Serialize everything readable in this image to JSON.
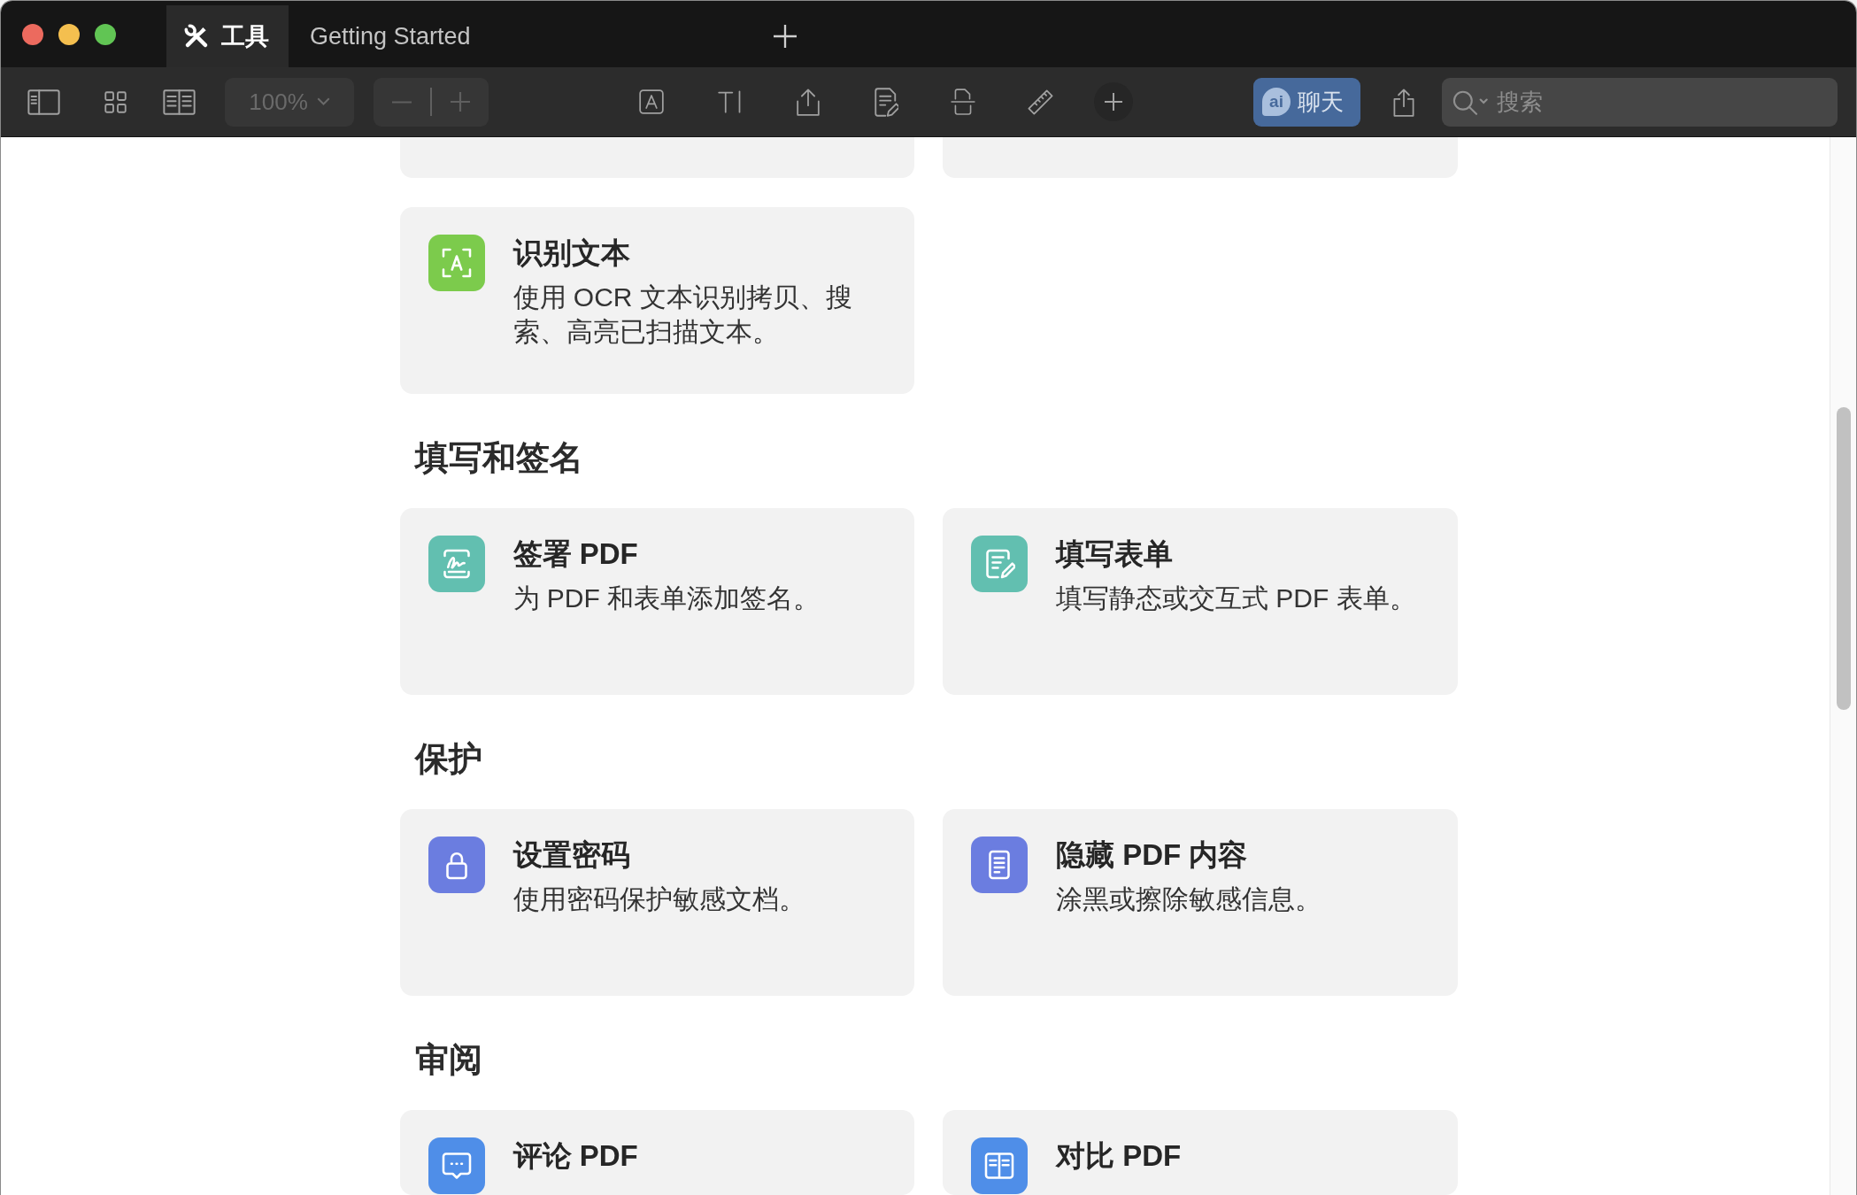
{
  "window": {
    "tabs": [
      {
        "label": "工具",
        "selected": true,
        "kind": "tools"
      },
      {
        "label": "Getting Started",
        "selected": false,
        "kind": "document"
      }
    ]
  },
  "toolbar": {
    "zoom_menu": {
      "value": "100%",
      "disabled": true
    },
    "zoom_stepper": {
      "disabled": true
    },
    "chat_button": {
      "badge": "ai",
      "label": "聊天"
    },
    "search": {
      "placeholder": "搜索"
    }
  },
  "sections": [
    {
      "cards": [
        {
          "kind": "clipped"
        },
        {
          "kind": "clipped"
        },
        {
          "kind": "ocr",
          "color": "#7ccb4c",
          "title": "识别文本",
          "description": "使用 OCR 文本识别拷贝、搜索、高亮已扫描文本。"
        }
      ]
    },
    {
      "title": "填写和签名",
      "cards": [
        {
          "kind": "signature",
          "color": "#62bfb0",
          "title": "签署 PDF",
          "description": "为 PDF 和表单添加签名。"
        },
        {
          "kind": "form",
          "color": "#62bfb0",
          "title": "填写表单",
          "description": "填写静态或交互式 PDF 表单。"
        }
      ]
    },
    {
      "title": "保护",
      "cards": [
        {
          "kind": "password",
          "color": "#6b7de0",
          "title": "设置密码",
          "description": "使用密码保护敏感文档。"
        },
        {
          "kind": "redaction",
          "color": "#6b7de0",
          "title": "隐藏 PDF 内容",
          "description": "涂黑或擦除敏感信息。"
        }
      ]
    },
    {
      "title": "审阅",
      "cards": [
        {
          "kind": "comment",
          "color": "#4f8ee8",
          "title": "评论 PDF"
        },
        {
          "kind": "compare",
          "color": "#4f8ee8",
          "title": "对比 PDF"
        }
      ]
    }
  ]
}
